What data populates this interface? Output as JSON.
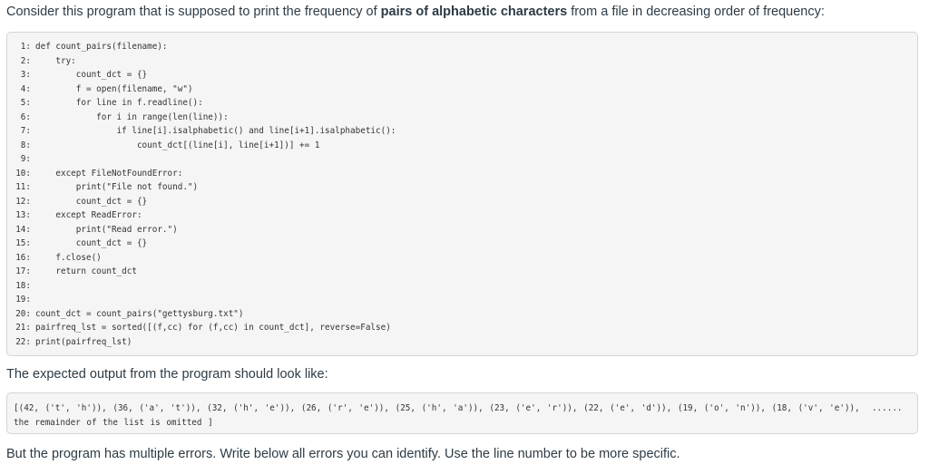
{
  "intro": {
    "before": "Consider this program that is supposed to print the frequency of ",
    "bold": "pairs of alphabetic characters",
    "after": " from a file in decreasing order of frequency:"
  },
  "code_lines": [
    {
      "num": "1:",
      "code": "def count_pairs(filename):"
    },
    {
      "num": "2:",
      "code": "    try:"
    },
    {
      "num": "3:",
      "code": "        count_dct = {}"
    },
    {
      "num": "4:",
      "code": "        f = open(filename, \"w\")"
    },
    {
      "num": "5:",
      "code": "        for line in f.readline():"
    },
    {
      "num": "6:",
      "code": "            for i in range(len(line)):"
    },
    {
      "num": "7:",
      "code": "                if line[i].isalphabetic() and line[i+1].isalphabetic():"
    },
    {
      "num": "8:",
      "code": "                    count_dct[(line[i], line[i+1])] += 1"
    },
    {
      "num": "9:",
      "code": ""
    },
    {
      "num": "10:",
      "code": "    except FileNotFoundError:"
    },
    {
      "num": "11:",
      "code": "        print(\"File not found.\")"
    },
    {
      "num": "12:",
      "code": "        count_dct = {}"
    },
    {
      "num": "13:",
      "code": "    except ReadError:"
    },
    {
      "num": "14:",
      "code": "        print(\"Read error.\")"
    },
    {
      "num": "15:",
      "code": "        count_dct = {}"
    },
    {
      "num": "16:",
      "code": "    f.close()"
    },
    {
      "num": "17:",
      "code": "    return count_dct"
    },
    {
      "num": "18:",
      "code": ""
    },
    {
      "num": "19:",
      "code": ""
    },
    {
      "num": "20:",
      "code": "count_dct = count_pairs(\"gettysburg.txt\")"
    },
    {
      "num": "21:",
      "code": "pairfreq_lst = sorted([(f,cc) for (f,cc) in count_dct], reverse=False)"
    },
    {
      "num": "22:",
      "code": "print(pairfreq_lst)"
    }
  ],
  "expected_label": "The expected output from the program should look like:",
  "expected_output": "[(42, ('t', 'h')), (36, ('a', 't')), (32, ('h', 'e')), (26, ('r', 'e')), (25, ('h', 'a')), (23, ('e', 'r')), (22, ('e', 'd')), (19, ('o', 'n')), (18, ('v', 'e')),  ...... the remainder of the list is omitted ]",
  "question": "But the program has multiple errors. Write below all errors you can identify. Use the line number to be more specific."
}
